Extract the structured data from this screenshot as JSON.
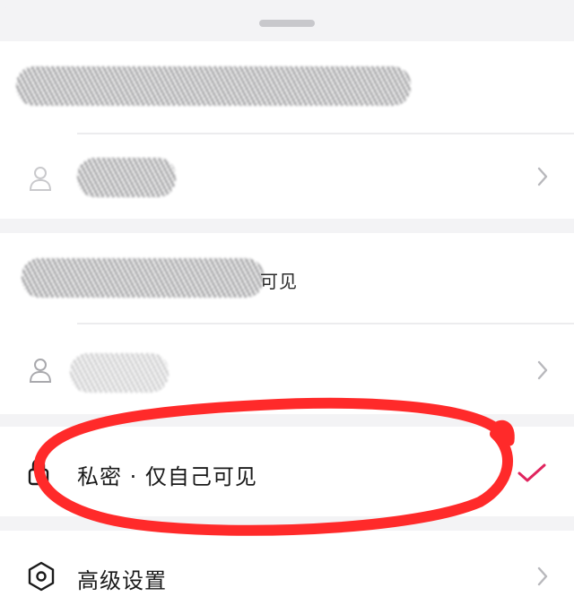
{
  "sheet": {
    "options": [
      {
        "id": "option-1",
        "text": "",
        "redacted": true
      },
      {
        "id": "option-2",
        "text": "",
        "redacted": true
      },
      {
        "id": "option-3",
        "text": "可见",
        "redacted": true
      },
      {
        "id": "option-4",
        "text": "",
        "redacted": true
      },
      {
        "id": "private",
        "text": "私密 · 仅自己可见",
        "selected": true
      },
      {
        "id": "advanced",
        "text": "高级设置"
      }
    ],
    "icons": {
      "person": "person-icon",
      "lock": "lock-icon",
      "gear": "hexagon-settings-icon",
      "chevron": "chevron-right-icon",
      "check": "checkmark-icon"
    },
    "colors": {
      "check": "#e0245e",
      "annotation": "#ff2a2a"
    }
  }
}
